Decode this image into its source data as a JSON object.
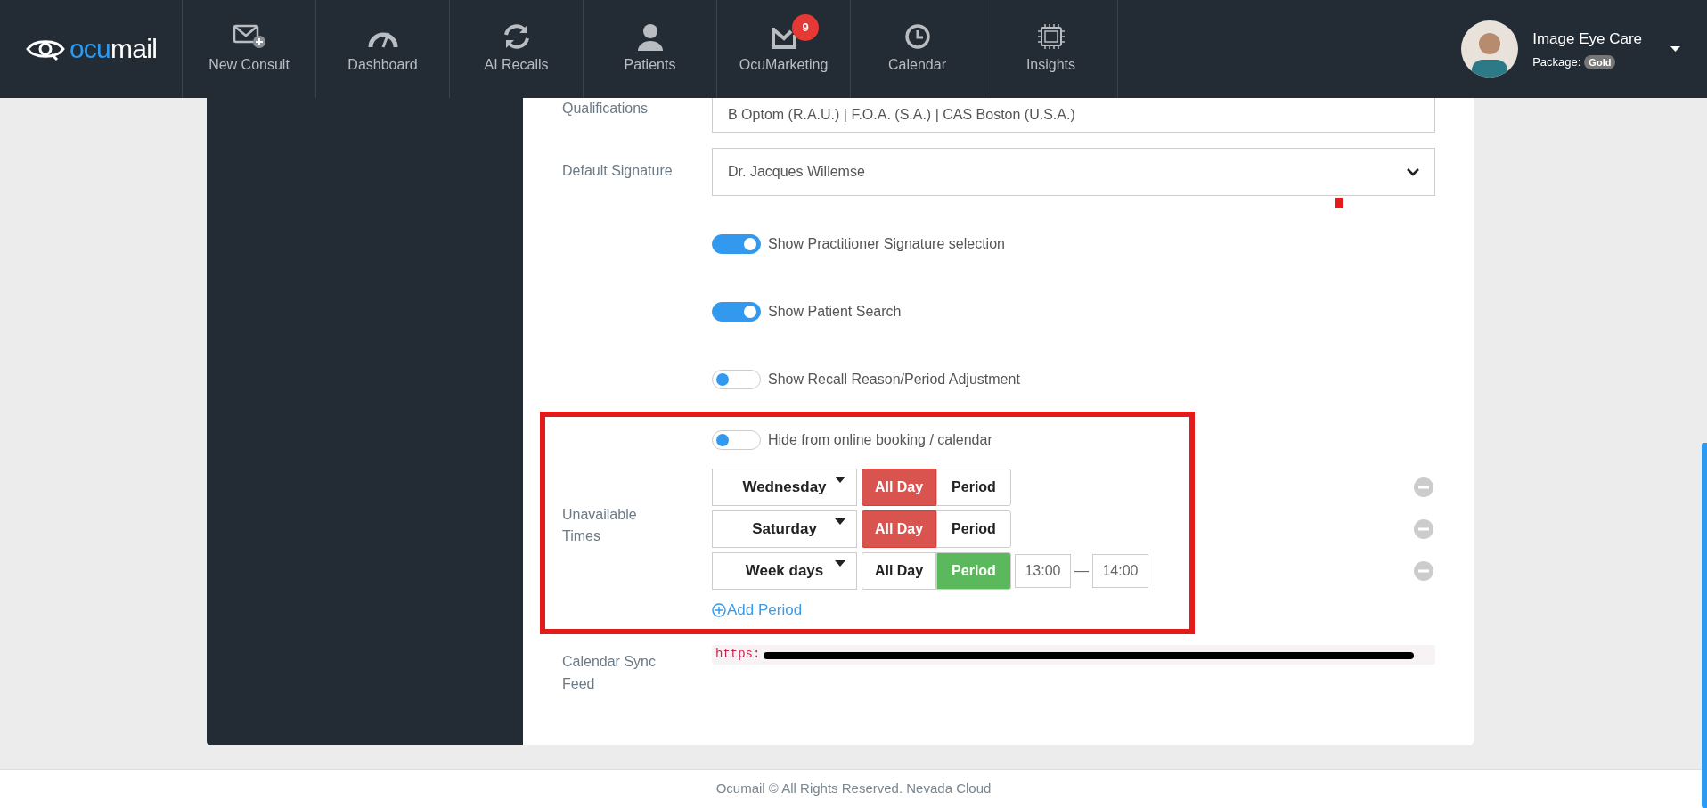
{
  "brand": {
    "prefix": "ocu",
    "suffix": "mail"
  },
  "nav": [
    {
      "label": "New Consult"
    },
    {
      "label": "Dashboard"
    },
    {
      "label": "AI Recalls"
    },
    {
      "label": "Patients"
    },
    {
      "label": "OcuMarketing",
      "badge": "9"
    },
    {
      "label": "Calendar"
    },
    {
      "label": "Insights"
    }
  ],
  "account": {
    "name": "Image Eye Care",
    "package_label": "Package:",
    "package": "Gold"
  },
  "form": {
    "qualifications": {
      "label": "Qualifications",
      "value": "B Optom (R.A.U.) | F.O.A. (S.A.) | CAS Boston (U.S.A.)"
    },
    "signature": {
      "label": "Default Signature",
      "value": "Dr. Jacques Willemse"
    },
    "toggles": [
      {
        "label": "Show Practitioner Signature selection",
        "on": true
      },
      {
        "label": "Show Patient Search",
        "on": true
      },
      {
        "label": "Show Recall Reason/Period Adjustment",
        "on": false
      }
    ],
    "unavailable": {
      "label": "Unavailable Times",
      "hide_toggle": {
        "label": "Hide from online booking / calendar",
        "on": false
      },
      "rows": [
        {
          "day": "Wednesday",
          "options": [
            {
              "label": "All Day",
              "selected": true,
              "kind": "allday"
            },
            {
              "label": "Period",
              "selected": false,
              "kind": "period"
            }
          ]
        },
        {
          "day": "Saturday",
          "options": [
            {
              "label": "All Day",
              "selected": true,
              "kind": "allday"
            },
            {
              "label": "Period",
              "selected": false,
              "kind": "period"
            }
          ]
        },
        {
          "day": "Week days",
          "options": [
            {
              "label": "All Day",
              "selected": false,
              "kind": "allday"
            },
            {
              "label": "Period",
              "selected": true,
              "kind": "period"
            }
          ],
          "from": "13:00",
          "separator": "—",
          "to": "14:00"
        }
      ],
      "add": "Add Period"
    },
    "sync": {
      "label": "Calendar Sync Feed",
      "value": "https:"
    }
  },
  "footer": "Ocumail © All Rights Reserved. Nevada Cloud"
}
